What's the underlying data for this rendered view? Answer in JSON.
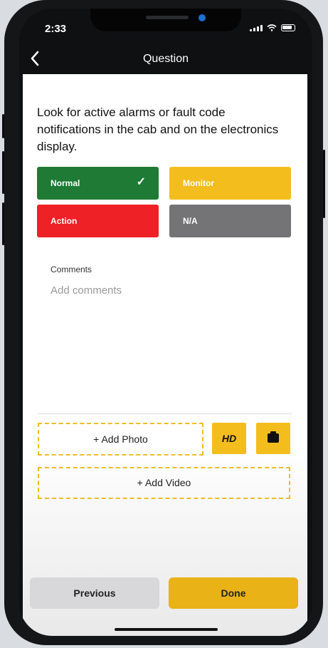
{
  "status_bar": {
    "time": "2:33"
  },
  "nav": {
    "title": "Question"
  },
  "question": {
    "text": "Look for active alarms or fault code notifications in the cab and on the electronics display."
  },
  "options": {
    "normal": {
      "label": "Normal",
      "selected": true,
      "color": "#1e7a34"
    },
    "monitor": {
      "label": "Monitor",
      "color": "#f4bd1e"
    },
    "action": {
      "label": "Action",
      "color": "#ee2126"
    },
    "na": {
      "label": "N/A",
      "color": "#747477"
    }
  },
  "comments": {
    "label": "Comments",
    "placeholder": "Add comments"
  },
  "media": {
    "add_photo": "+ Add Photo",
    "hd": "HD",
    "add_video": "+ Add Video"
  },
  "footer": {
    "previous": "Previous",
    "done": "Done"
  }
}
